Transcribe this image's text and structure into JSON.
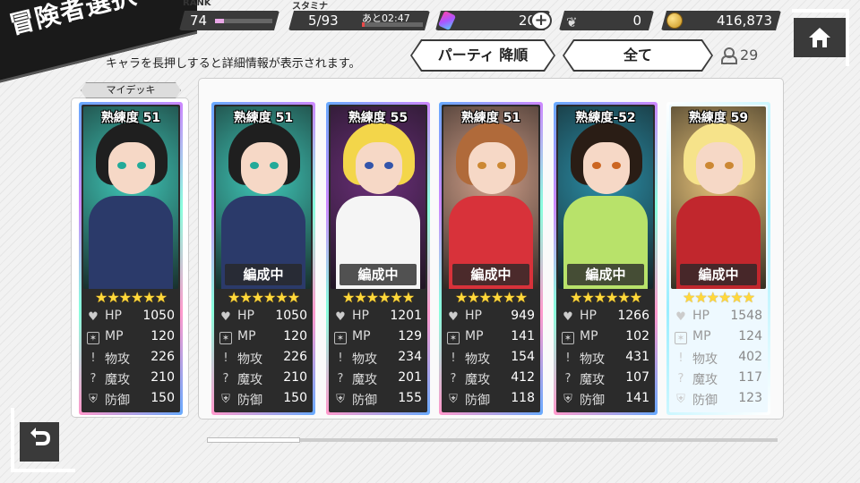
{
  "screen_title": "冒険者選択",
  "status": {
    "rank_label": "RANK",
    "rank": "74",
    "rank_progress": 0.15,
    "stamina_label": "スタミナ",
    "stamina": "5/93",
    "stamina_timer": "あと02:47",
    "stamina_progress": 0.05,
    "gems": "20",
    "feathers": "0",
    "coins": "416,873",
    "plus_label": "+"
  },
  "hint_text": "キャラを長押しすると詳細情報が表示されます。",
  "sort": {
    "party_sort_label": "パーティ 降順",
    "filter_label": "全て"
  },
  "adventurer_count": "29",
  "my_deck_label": "マイデッキ",
  "icons": {
    "home": "home-icon",
    "back": "back-arrow-icon",
    "gem": "gem-icon",
    "feather": "feather-icon",
    "coin": "coin-icon",
    "person": "person-icon"
  },
  "colors": {
    "dark": "#3a3a3a",
    "star": "#ffd83b",
    "stamina_fill": "#e94a4a",
    "rank_fill": "#e9a7e6"
  },
  "cards": [
    {
      "proficiency": "熟練度 51",
      "in_party": "",
      "stars": "★★★★★★",
      "hp": "1050",
      "mp": "120",
      "atk": "226",
      "mag": "210",
      "def": "150",
      "hair": "#1f1f1f",
      "outfit": "#2b3a6a",
      "bg": "#3fc7b8",
      "eye": "#2a9"
    },
    {
      "proficiency": "熟練度 51",
      "in_party": "編成中",
      "stars": "★★★★★★",
      "hp": "1050",
      "mp": "120",
      "atk": "226",
      "mag": "210",
      "def": "150",
      "hair": "#1f1f1f",
      "outfit": "#2b3a6a",
      "bg": "#3fc7b8",
      "eye": "#2a9"
    },
    {
      "proficiency": "熟練度 55",
      "in_party": "編成中",
      "stars": "★★★★★★",
      "hp": "1201",
      "mp": "129",
      "atk": "234",
      "mag": "201",
      "def": "155",
      "hair": "#f3d64a",
      "outfit": "#f5f5f5",
      "bg": "#6b2f7a",
      "eye": "#35a"
    },
    {
      "proficiency": "熟練度 51",
      "in_party": "編成中",
      "stars": "★★★★★★",
      "hp": "949",
      "mp": "141",
      "atk": "154",
      "mag": "412",
      "def": "118",
      "hair": "#b06a3a",
      "outfit": "#d8323a",
      "bg": "#d2a08a",
      "eye": "#c83"
    },
    {
      "proficiency": "熟練度-52",
      "in_party": "編成中",
      "stars": "★★★★★★",
      "hp": "1266",
      "mp": "102",
      "atk": "431",
      "mag": "107",
      "def": "141",
      "hair": "#2a1d15",
      "outfit": "#b8e26a",
      "bg": "#2b8fa8",
      "eye": "#c62"
    },
    {
      "proficiency": "熟練度 59",
      "in_party": "編成中",
      "stars": "★★★★★★",
      "hp": "1548",
      "mp": "124",
      "atk": "402",
      "mag": "117",
      "def": "123",
      "hair": "#f6e38a",
      "outfit": "#c1272d",
      "bg": "#e8c37a",
      "eye": "#c83"
    }
  ],
  "stat_labels": {
    "hp": "HP",
    "mp": "MP",
    "atk": "物攻",
    "mag": "魔攻",
    "def": "防御"
  },
  "scroll_position": 0.16
}
